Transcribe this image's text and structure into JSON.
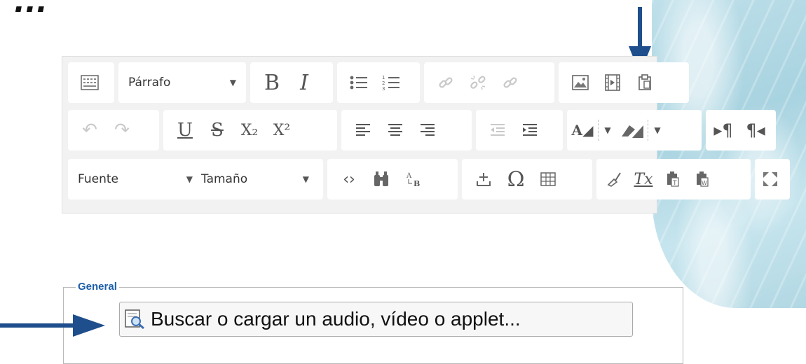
{
  "header": {
    "title_fragment": "..."
  },
  "toolbar": {
    "paragraph_format": "Párrafo",
    "font_family": "Fuente",
    "font_size": "Tamaño",
    "bold": "B",
    "italic": "I",
    "underline": "U",
    "strike": "S",
    "subscript": "X₂",
    "superscript": "X²",
    "special_char": "Ω",
    "clear_format": "Tx",
    "icons_row1": [
      "toolbar-toggle-icon",
      "image-icon",
      "media-icon",
      "paste-icon",
      "bullet-list-icon",
      "numbered-list-icon",
      "link-icon",
      "unlink-icon",
      "anchor-icon"
    ],
    "icons_row2": [
      "undo-icon",
      "redo-icon",
      "align-left-icon",
      "align-center-icon",
      "align-right-icon",
      "outdent-icon",
      "indent-icon",
      "text-color-icon",
      "background-color-icon",
      "ltr-icon",
      "rtl-icon"
    ],
    "icons_row3": [
      "source-code-icon",
      "find-icon",
      "replace-icon",
      "anchor-insert-icon",
      "table-icon",
      "format-painter-icon",
      "paste-text-icon",
      "paste-word-icon",
      "fullscreen-icon"
    ]
  },
  "form": {
    "legend": "General",
    "picker_label": "Buscar o cargar un audio, vídeo o applet..."
  },
  "colors": {
    "arrow": "#1f4e8c",
    "legend": "#1d5fa8",
    "toolbar_bg": "#f2f2f2"
  }
}
